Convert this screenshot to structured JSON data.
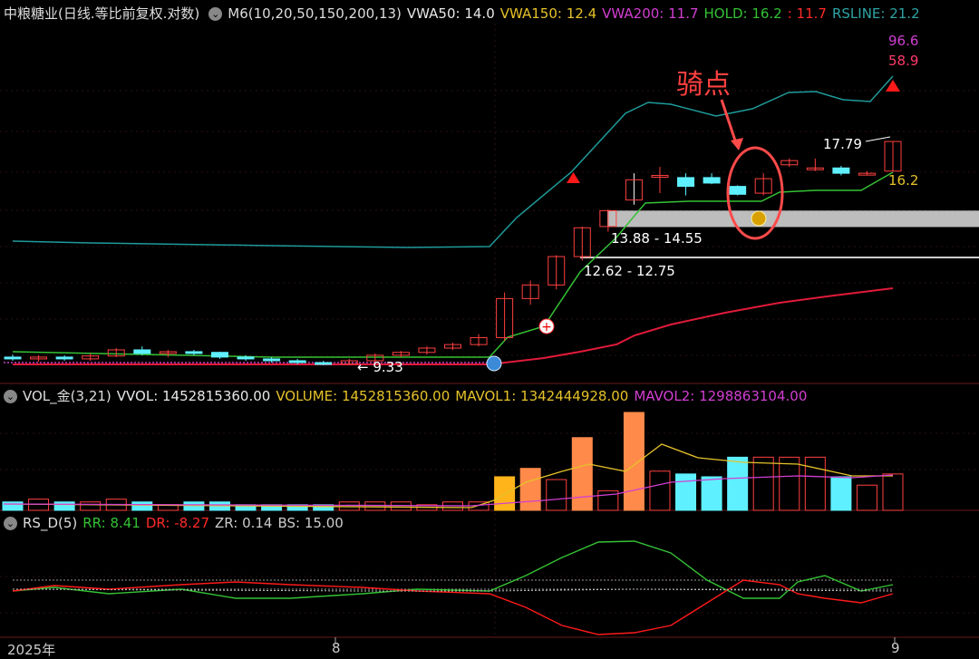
{
  "main_panel": {
    "title": "中粮糖业(日线.等比前复权.对数)",
    "indicator": "M6(10,20,50,150,200,13)",
    "readouts": [
      {
        "label": "VWA50: 14.0",
        "color": "#e8e8e8"
      },
      {
        "label": "VWA150: 12.4",
        "color": "#e6c229"
      },
      {
        "label": "VWA200: 11.7",
        "color": "#d23fd2"
      },
      {
        "label": "HOLD: 16.2",
        "color": "#34c234"
      },
      {
        "label": ": 11.7",
        "color": "#ff2a2a"
      },
      {
        "label": "RSLINE: 21.2",
        "color": "#2fa3a3"
      }
    ],
    "right_values": [
      {
        "text": "96.6",
        "color": "#d23fd2"
      },
      {
        "text": "58.9",
        "color": "#ff3a6a"
      }
    ],
    "annotation_title": "骑点",
    "price_labels": [
      "17.79",
      "16.2",
      "13.88 - 14.55",
      "12.62 - 12.75",
      "← 9.33"
    ]
  },
  "volume_panel": {
    "title": "VOL_金(3,21)",
    "readouts": [
      {
        "label": "VVOL: 1452815360.00",
        "color": "#e8e8e8"
      },
      {
        "label": "VOLUME: 1452815360.00",
        "color": "#e6c229"
      },
      {
        "label": "MAVOL1: 1342444928.00",
        "color": "#e6c229"
      },
      {
        "label": "MAVOL2: 1298863104.00",
        "color": "#d23fd2"
      }
    ]
  },
  "rs_panel": {
    "title": "RS_D(5)",
    "readouts": [
      {
        "label": "RR: 8.41",
        "color": "#34c234"
      },
      {
        "label": "DR: -8.27",
        "color": "#ff2a2a"
      },
      {
        "label": "ZR: 0.14",
        "color": "#cccccc"
      },
      {
        "label": "BS: 15.00",
        "color": "#cccccc"
      }
    ]
  },
  "x_axis": [
    "2025年",
    "8",
    "9"
  ],
  "chart_data": {
    "type": "candlestick",
    "candles": [
      {
        "o": 9.55,
        "h": 9.62,
        "l": 9.45,
        "c": 9.5
      },
      {
        "o": 9.5,
        "h": 9.6,
        "l": 9.42,
        "c": 9.55
      },
      {
        "o": 9.55,
        "h": 9.6,
        "l": 9.45,
        "c": 9.5
      },
      {
        "o": 9.5,
        "h": 9.65,
        "l": 9.45,
        "c": 9.58
      },
      {
        "o": 9.58,
        "h": 9.8,
        "l": 9.55,
        "c": 9.75
      },
      {
        "o": 9.75,
        "h": 9.85,
        "l": 9.6,
        "c": 9.65
      },
      {
        "o": 9.65,
        "h": 9.75,
        "l": 9.55,
        "c": 9.7
      },
      {
        "o": 9.7,
        "h": 9.75,
        "l": 9.6,
        "c": 9.68
      },
      {
        "o": 9.68,
        "h": 9.7,
        "l": 9.5,
        "c": 9.55
      },
      {
        "o": 9.55,
        "h": 9.6,
        "l": 9.45,
        "c": 9.5
      },
      {
        "o": 9.5,
        "h": 9.55,
        "l": 9.4,
        "c": 9.45
      },
      {
        "o": 9.45,
        "h": 9.5,
        "l": 9.35,
        "c": 9.4
      },
      {
        "o": 9.4,
        "h": 9.45,
        "l": 9.33,
        "c": 9.36
      },
      {
        "o": 9.36,
        "h": 9.5,
        "l": 9.33,
        "c": 9.45
      },
      {
        "o": 9.45,
        "h": 9.65,
        "l": 9.4,
        "c": 9.6
      },
      {
        "o": 9.6,
        "h": 9.72,
        "l": 9.55,
        "c": 9.68
      },
      {
        "o": 9.68,
        "h": 9.85,
        "l": 9.62,
        "c": 9.8
      },
      {
        "o": 9.8,
        "h": 9.95,
        "l": 9.75,
        "c": 9.9
      },
      {
        "o": 9.9,
        "h": 10.2,
        "l": 9.85,
        "c": 10.1
      },
      {
        "o": 10.1,
        "h": 11.5,
        "l": 10.0,
        "c": 11.3
      },
      {
        "o": 11.3,
        "h": 11.9,
        "l": 11.1,
        "c": 11.75
      },
      {
        "o": 11.75,
        "h": 12.8,
        "l": 11.6,
        "c": 12.75
      },
      {
        "o": 12.75,
        "h": 13.9,
        "l": 12.6,
        "c": 13.85
      },
      {
        "o": 13.9,
        "h": 14.6,
        "l": 13.7,
        "c": 14.55
      },
      {
        "o": 15.0,
        "h": 16.2,
        "l": 14.8,
        "c": 15.9
      },
      {
        "o": 16.1,
        "h": 16.5,
        "l": 15.3,
        "c": 16.1
      },
      {
        "o": 16.0,
        "h": 16.2,
        "l": 15.2,
        "c": 15.6
      },
      {
        "o": 16.0,
        "h": 16.2,
        "l": 15.7,
        "c": 15.75
      },
      {
        "o": 15.6,
        "h": 15.65,
        "l": 15.2,
        "c": 15.25
      },
      {
        "o": 15.3,
        "h": 16.2,
        "l": 15.2,
        "c": 15.95
      },
      {
        "o": 16.6,
        "h": 16.9,
        "l": 16.5,
        "c": 16.8
      },
      {
        "o": 16.4,
        "h": 16.9,
        "l": 16.3,
        "c": 16.45
      },
      {
        "o": 16.45,
        "h": 16.55,
        "l": 16.1,
        "c": 16.2
      },
      {
        "o": 16.2,
        "h": 16.3,
        "l": 16.1,
        "c": 16.2
      },
      {
        "o": 16.3,
        "h": 17.75,
        "l": 16.3,
        "c": 17.75
      }
    ],
    "volume": [
      3,
      4,
      3,
      3,
      4,
      3,
      2,
      3,
      3,
      2,
      2,
      2,
      2,
      3,
      3,
      3,
      2,
      3,
      3,
      12,
      15,
      11,
      26,
      7,
      35,
      14,
      13,
      12,
      19,
      19,
      19,
      19,
      12,
      9,
      13
    ],
    "annotations": [
      "17.79",
      "16.2",
      "13.88 - 14.55",
      "12.62 - 12.75",
      "9.33",
      "96.6",
      "58.9"
    ]
  }
}
